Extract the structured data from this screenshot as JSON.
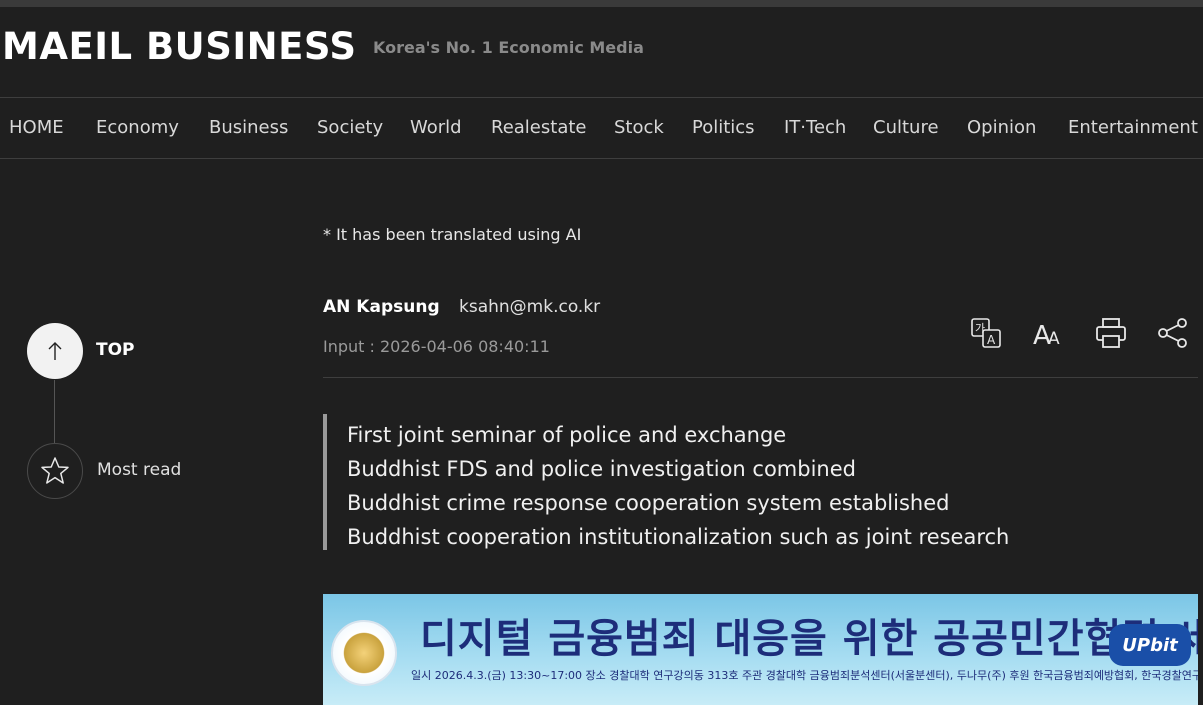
{
  "header": {
    "logo": "MAEIL BUSINESS",
    "tagline": "Korea's No. 1 Economic Media"
  },
  "nav": {
    "items": [
      "HOME",
      "Economy",
      "Business",
      "Society",
      "World",
      "Realestate",
      "Stock",
      "Politics",
      "IT·Tech",
      "Culture",
      "Opinion",
      "Entertainment"
    ]
  },
  "side_rail": {
    "top_label": "TOP",
    "most_read_label": "Most read"
  },
  "article": {
    "ai_note": "* It has been translated using AI",
    "author": "AN Kapsung",
    "email": "ksahn@mk.co.kr",
    "input_time": "Input : 2026-04-06 08:40:11",
    "summary": [
      "First joint seminar of police and exchange",
      "Buddhist FDS and police investigation combined",
      "Buddhist crime response cooperation system established",
      "Buddhist cooperation institutionalization such as joint research"
    ],
    "tools": [
      "translate-icon",
      "font-size-icon",
      "print-icon",
      "share-icon"
    ]
  },
  "banner": {
    "title": "디지털 금융범죄 대응을 위한 공공민간협력 세미나",
    "subtitle": "일시 2026.4.3.(금) 13:30~17:00   장소 경찰대학 연구강의동 313호   주관 경찰대학 금융범죄분석센터(서울분센터), 두나무(주)   후원 한국금융범죄예방협회, 한국경찰연구학회",
    "logo_text": "UPbit"
  }
}
